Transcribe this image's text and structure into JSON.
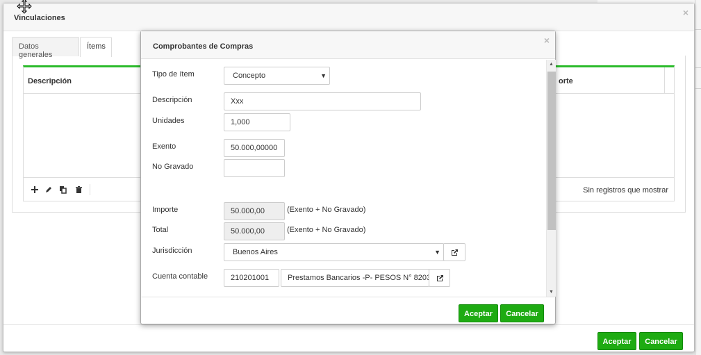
{
  "outer": {
    "title": "Vinculaciones",
    "close": "×",
    "tabs": [
      "Datos generales",
      "Ítems"
    ],
    "grid": {
      "columns": [
        "Descripción",
        "orte"
      ],
      "empty_text": "Sin registros que mostrar",
      "tool_icons": [
        "plus-icon",
        "pencil-icon",
        "copy-icon",
        "trash-icon"
      ]
    },
    "accept_label": "Aceptar",
    "cancel_label": "Cancelar"
  },
  "inner": {
    "title": "Comprobantes de Compras",
    "close": "×",
    "fields": {
      "tipo_item": {
        "label": "Tipo de ítem",
        "value": "Concepto"
      },
      "descripcion": {
        "label": "Descripción",
        "value": "Xxx"
      },
      "unidades": {
        "label": "Unidades",
        "value": "1,000"
      },
      "exento": {
        "label": "Exento",
        "value": "50.000,00000"
      },
      "no_gravado": {
        "label": "No Gravado",
        "value": ""
      },
      "importe": {
        "label": "Importe",
        "value": "50.000,00",
        "note": "(Exento + No Gravado)"
      },
      "total": {
        "label": "Total",
        "value": "50.000,00",
        "note": "(Exento + No Gravado)"
      },
      "jurisdiccion": {
        "label": "Jurisdicción",
        "value": "Buenos Aires"
      },
      "cuenta_contable": {
        "label": "Cuenta contable",
        "code": "210201001",
        "name": "Prestamos Bancarios -P- PESOS N° 8203"
      }
    },
    "accept_label": "Aceptar",
    "cancel_label": "Cancelar"
  },
  "colors": {
    "accent_green": "#1eab12",
    "grid_top_border": "#2bbb2b"
  }
}
